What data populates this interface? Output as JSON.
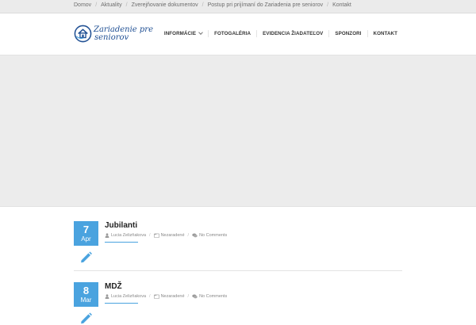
{
  "breadcrumbs": [
    "Domov",
    "Aktuality",
    "Zverejňovanie dokumentov",
    "Postup pri prijímaní do Zariadenia pre seniorov",
    "Kontakt"
  ],
  "breadcrumb_separator": "/",
  "logo": {
    "line1": "Zariadenie pre",
    "line2": "seniorov",
    "icon": "house-circle-icon",
    "color": "#1f4f93"
  },
  "nav": [
    {
      "label": "INFORMÁCIE",
      "has_dropdown": true
    },
    {
      "label": "FOTOGALÉRIA"
    },
    {
      "label": "EVIDENCIA ŽIADATEĽOV"
    },
    {
      "label": "SPONZORI"
    },
    {
      "label": "KONTAKT"
    }
  ],
  "posts": [
    {
      "day": "7",
      "month": "Apr",
      "title": "Jubilanti",
      "author": "Lucia Zelizňakova",
      "category": "Nezaradené",
      "comments": "No Comments"
    },
    {
      "day": "8",
      "month": "Mar",
      "title": "MDŽ",
      "author": "Lucia Zelizňakova",
      "category": "Nezaradené",
      "comments": "No Comments"
    }
  ],
  "colors": {
    "accent": "#4aa3df",
    "topbar": "#ebebeb",
    "hero": "#ececec"
  }
}
